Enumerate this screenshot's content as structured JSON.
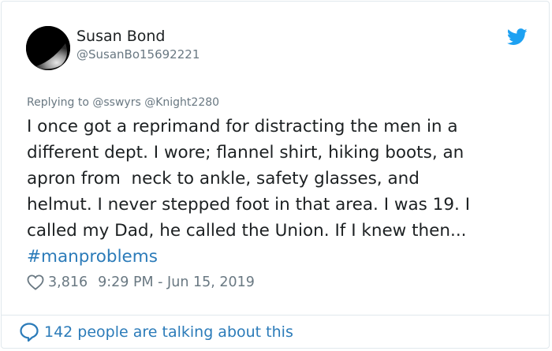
{
  "user": {
    "name": "Susan Bond",
    "handle": "@SusanBo15692221"
  },
  "reply": {
    "prefix": "Replying to",
    "mentions": [
      "@sswyrs",
      "@Knight2280"
    ]
  },
  "tweet": {
    "lines": [
      "I once got a reprimand for distracting the men in a",
      "different dept. I wore; flannel shirt, hiking boots, an",
      "apron from  neck to ankle, safety glasses, and",
      "helmut. I never stepped foot in that area. I was 19. I",
      "called my Dad, he called the Union. If I knew then..."
    ],
    "hashtag": "#manproblems"
  },
  "meta": {
    "likes": "3,816",
    "timestamp": "9:29 PM - Jun 15, 2019"
  },
  "footer": {
    "label": "142 people are talking about this"
  },
  "icons": {
    "brand": "twitter-bird-icon",
    "like": "heart-icon",
    "conversation": "speech-bubble-icon"
  },
  "colors": {
    "link": "#2b7bb9",
    "brand": "#1da1f2",
    "muted": "#697882",
    "text": "#1c2022",
    "border": "#e1e8ed"
  }
}
